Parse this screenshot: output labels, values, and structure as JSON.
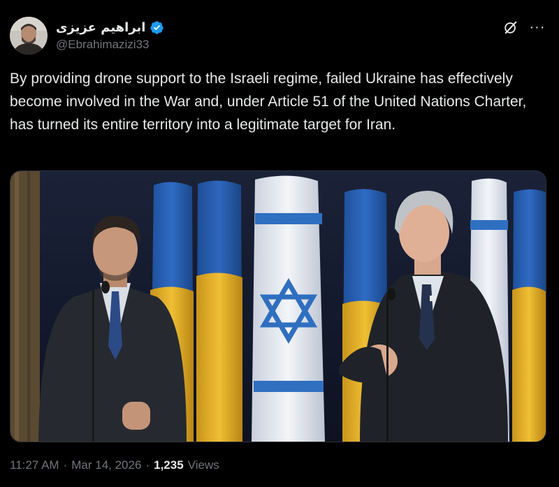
{
  "author": {
    "display_name": "ابراهیم عزیزی",
    "handle": "@Ebrahimazizi33",
    "avatar_icon": "avatar-photo",
    "verified_icon": "verified-badge-icon",
    "verified_color": "#1d9bf0"
  },
  "actions": {
    "grok_icon": "grok-icon",
    "more_label": "···"
  },
  "tweet": {
    "text": "By providing drone support to the Israeli regime, failed Ukraine has effectively become involved in the War and, under Article 51 of the United Nations Charter, has turned its entire territory into a legitimate target for Iran."
  },
  "media": {
    "type": "photo",
    "flag_colors": {
      "ukraine_blue": "#2b63b8",
      "ukraine_yellow": "#e6b52a",
      "israel_blue": "#2f6fc0",
      "israel_white": "#eef1f6"
    }
  },
  "meta": {
    "time": "11:27 AM",
    "separator": "·",
    "date": "Mar 14, 2026",
    "views_count": "1,235",
    "views_label": "Views"
  },
  "colors": {
    "background": "#000000",
    "text_primary": "#e7e9ea",
    "text_secondary": "#71767b"
  }
}
